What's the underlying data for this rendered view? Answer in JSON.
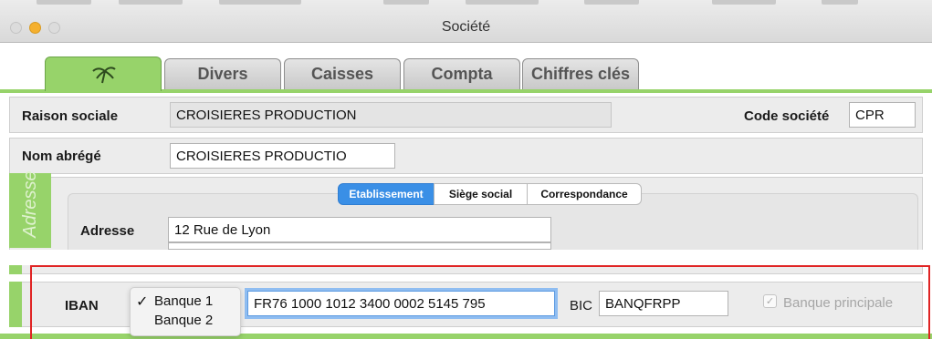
{
  "window": {
    "title": "Société"
  },
  "tabs": [
    {
      "label": "",
      "icon": "palm-tree-icon",
      "active": true
    },
    {
      "label": "Divers"
    },
    {
      "label": "Caisses"
    },
    {
      "label": "Compta"
    },
    {
      "label": "Chiffres clés"
    }
  ],
  "form": {
    "raison_sociale": {
      "label": "Raison sociale",
      "value": "CROISIERES PRODUCTION"
    },
    "code_societe": {
      "label": "Code société",
      "value": "CPR"
    },
    "nom_abrege": {
      "label": "Nom abrégé",
      "value": "CROISIERES PRODUCTIO"
    }
  },
  "address": {
    "group_label": "Adresse",
    "segments": [
      "Etablissement",
      "Siège social",
      "Correspondance"
    ],
    "selected_segment": "Etablissement",
    "adresse_label": "Adresse",
    "adresse_value": "12 Rue de Lyon",
    "adresse_value_2": ""
  },
  "bank": {
    "iban_label": "IBAN",
    "options": [
      "Banque 1",
      "Banque 2"
    ],
    "selected": "Banque 1",
    "iban_value": "FR76 1000 1012 3400 0002 5145 795",
    "bic_label": "BIC",
    "bic_value": "BANQFRPP",
    "principal_label": "Banque principale",
    "principal_checked": true
  },
  "colors": {
    "accent_green": "#97d36a",
    "segment_selected": "#3a8fe6",
    "highlight_box": "#e02424"
  }
}
